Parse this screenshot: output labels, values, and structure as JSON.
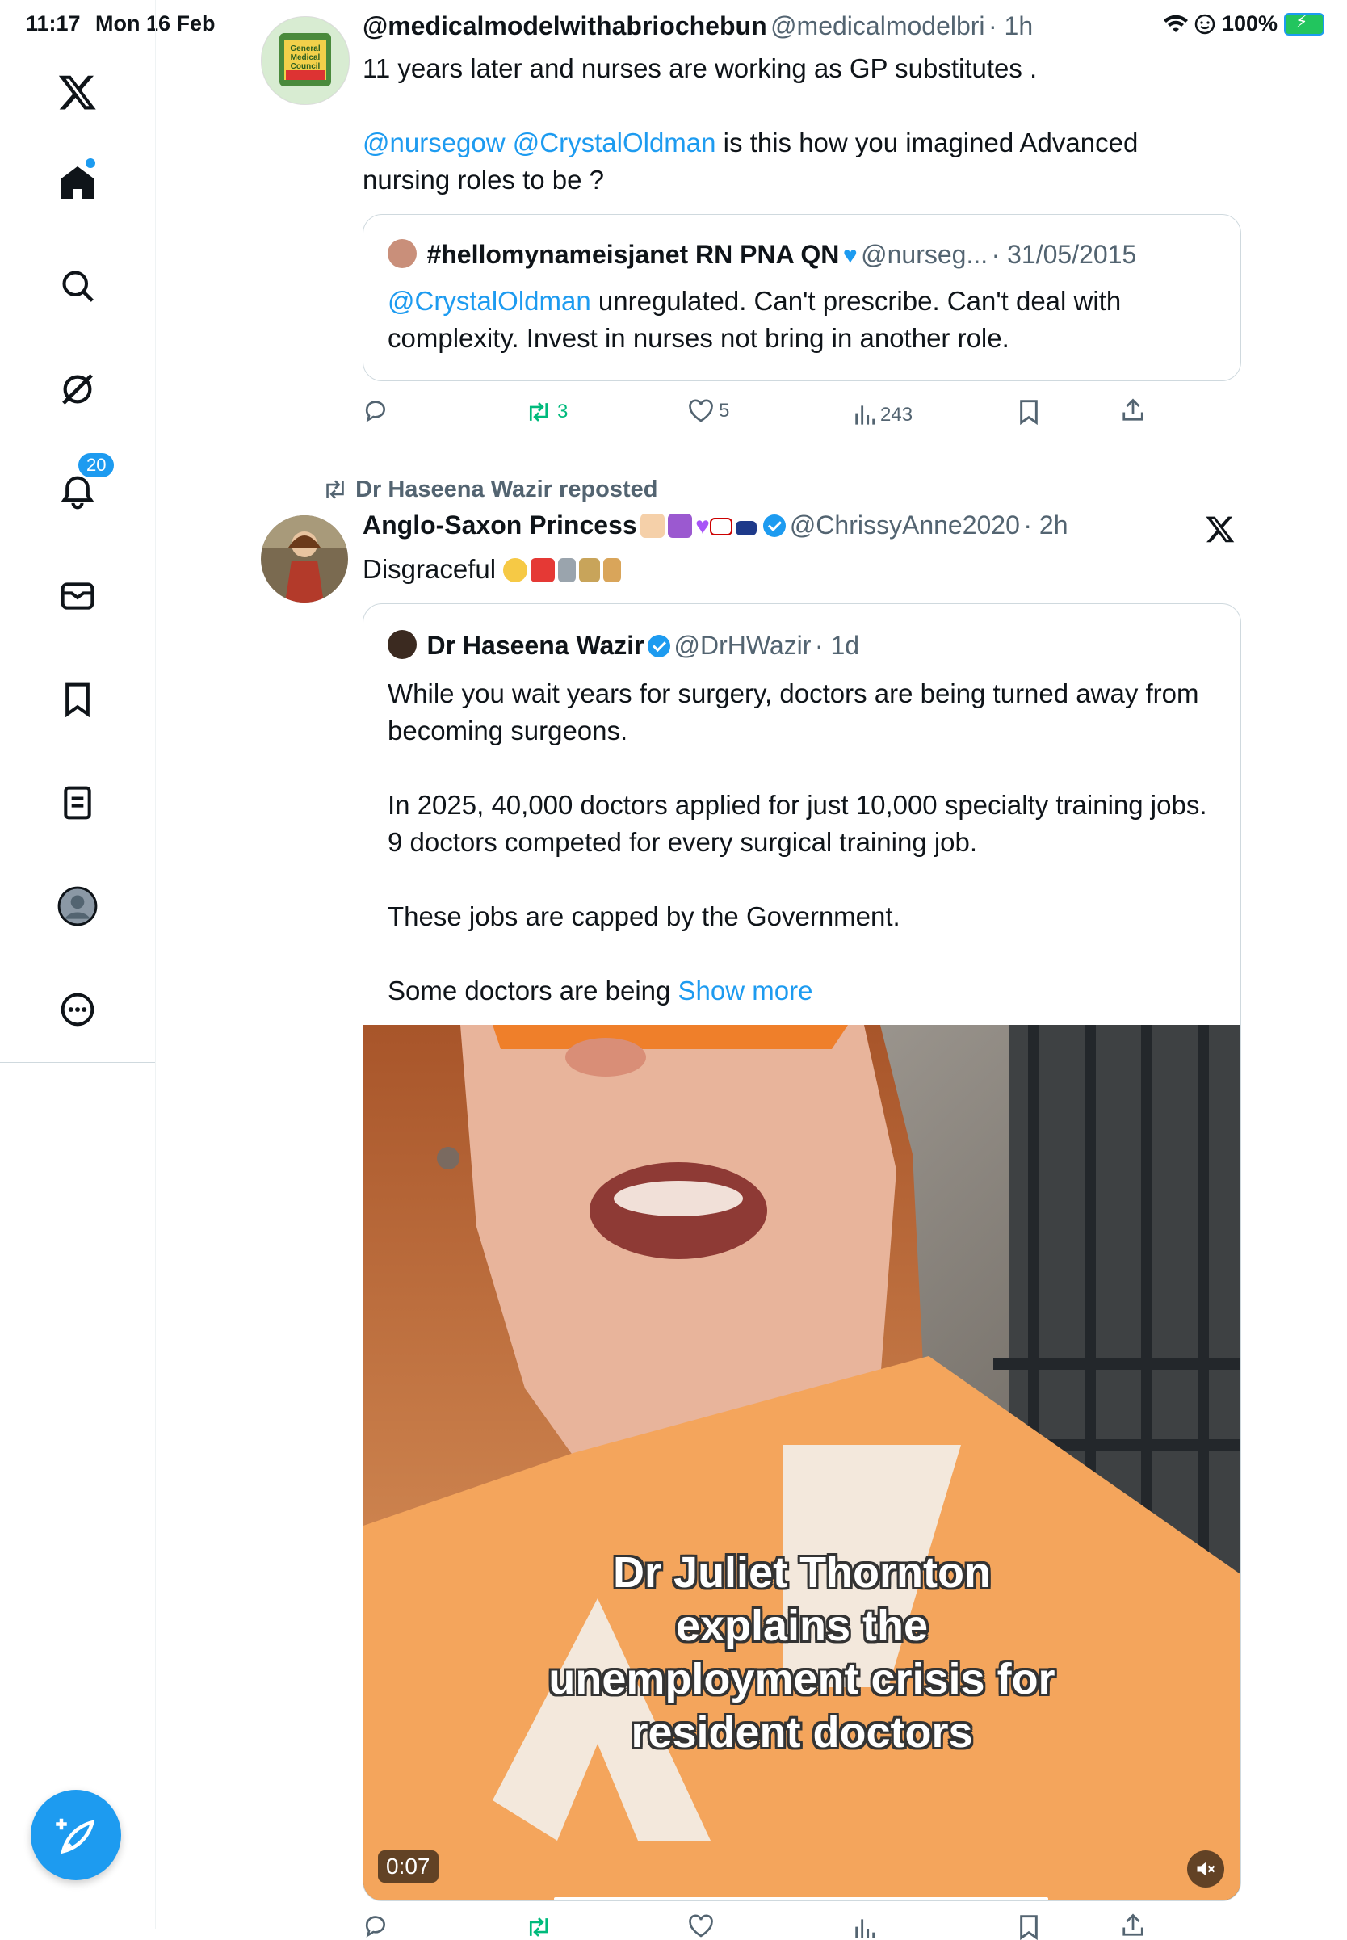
{
  "status_bar": {
    "time": "11:17",
    "date": "Mon 16 Feb",
    "battery": "100%"
  },
  "sidebar": {
    "notifications_badge": "20"
  },
  "tweet1": {
    "display_name": "@medicalmodelwithabriochebun",
    "handle": "@medicalmodelbri",
    "time": "· 1h",
    "avatar_text": "General Medical Council",
    "text_line1": "11 years later and nurses are working as GP substitutes .",
    "mention1": "@nursegow",
    "mention2": "@CrystalOldman",
    "text_rest": " is this how you imagined Advanced nursing roles to be ?",
    "quote": {
      "display_name": "#hellomynameisjanet RN PNA QN",
      "handle": "@nurseg...",
      "time": "· 31/05/2015",
      "mention": "@CrystalOldman",
      "text": " unregulated. Can't prescribe. Can't deal with complexity. Invest in nurses not bring in another role."
    },
    "stats": {
      "replies": "",
      "reposts": "3",
      "likes": "5",
      "views": "243"
    }
  },
  "tweet2": {
    "repost_label": "Dr Haseena Wazir reposted",
    "display_name": "Anglo-Saxon Princess",
    "handle": "@ChrissyAnne2020",
    "time": "· 2h",
    "text": "Disgraceful",
    "quote": {
      "display_name": "Dr Haseena Wazir",
      "handle": "@DrHWazir",
      "time": "· 1d",
      "p1": "While you wait years for surgery, doctors are being turned away from becoming surgeons.",
      "p2": "In 2025, 40,000 doctors applied for just 10,000 specialty training jobs. 9 doctors competed for every surgical training job.",
      "p3": "These jobs are capped by the Government.",
      "p4": "Some doctors are being ",
      "show_more": "Show more"
    },
    "video": {
      "caption_l1": "Dr Juliet Thornton",
      "caption_l2": "explains the",
      "caption_l3": "unemployment crisis for",
      "caption_l4": "resident doctors",
      "duration": "0:07"
    }
  },
  "colors": {
    "accent": "#1d9bf0",
    "repost_green": "#00ba7c",
    "text": "#0f1419",
    "muted": "#536471"
  },
  "icons": [
    "x-logo-icon",
    "home-icon",
    "search-icon",
    "grok-icon",
    "bell-icon",
    "mail-icon",
    "bookmark-icon",
    "lists-icon",
    "profile-icon",
    "more-icon",
    "compose-icon",
    "reply-icon",
    "repost-icon",
    "like-icon",
    "views-icon",
    "share-icon",
    "mute-icon"
  ]
}
